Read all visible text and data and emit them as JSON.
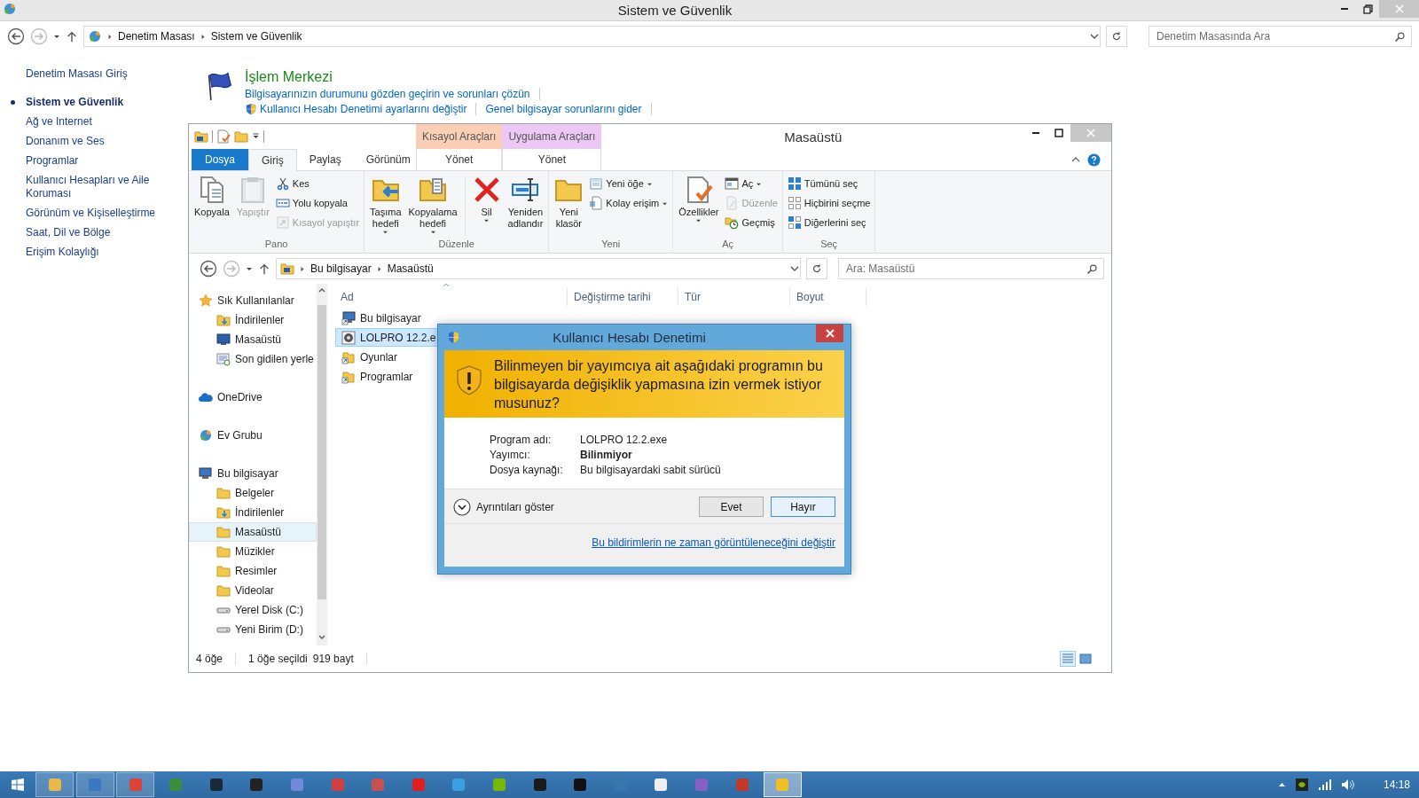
{
  "window": {
    "title": "Sistem ve Güvenlik"
  },
  "address_bar": {
    "path": [
      "Denetim Masası",
      "Sistem ve Güvenlik"
    ]
  },
  "search": {
    "placeholder": "Denetim Masasında Ara"
  },
  "sidebar": {
    "items": [
      {
        "label": "Denetim Masası Giriş",
        "kind": "home",
        "selected": false
      },
      {
        "label": "Sistem ve Güvenlik",
        "kind": "category",
        "selected": true
      },
      {
        "label": "Ağ ve Internet",
        "kind": "category",
        "selected": false
      },
      {
        "label": "Donanım ve Ses",
        "kind": "category",
        "selected": false
      },
      {
        "label": "Programlar",
        "kind": "category",
        "selected": false
      },
      {
        "label": "Kullanıcı Hesapları ve Aile Koruması",
        "kind": "category",
        "selected": false
      },
      {
        "label": "Görünüm ve Kişiselleştirme",
        "kind": "category",
        "selected": false
      },
      {
        "label": "Saat, Dil ve Bölge",
        "kind": "category",
        "selected": false
      },
      {
        "label": "Erişim Kolaylığı",
        "kind": "category",
        "selected": false
      }
    ]
  },
  "section": {
    "title": "İşlem Merkezi",
    "lines": [
      [
        {
          "label": "Bilgisayarınızın durumunu gözden geçirin ve sorunları çözün",
          "shield": false
        }
      ],
      [
        {
          "label": "Kullanıcı Hesabı Denetimi ayarlarını değiştir",
          "shield": true
        },
        {
          "label": "Genel bilgisayar sorunlarını gider",
          "shield": false
        }
      ]
    ]
  },
  "explorer": {
    "title": "Masaüstü",
    "tabs": [
      {
        "label": "Dosya",
        "kind": "file",
        "selected": false
      },
      {
        "label": "Giriş",
        "kind": "normal",
        "selected": true
      },
      {
        "label": "Paylaş",
        "kind": "normal",
        "selected": false
      },
      {
        "label": "Görünüm",
        "kind": "normal",
        "selected": false
      }
    ],
    "context_groups": [
      {
        "label": "Kısayol Araçları",
        "color": "#fbcfb6",
        "tabs": [
          {
            "label": "Yönet",
            "selected": false
          }
        ]
      },
      {
        "label": "Uygulama Araçları",
        "color": "#ecc8f4",
        "tabs": [
          {
            "label": "Yönet",
            "selected": false
          }
        ]
      }
    ],
    "groups": [
      {
        "label": "Pano",
        "items": [
          {
            "label": "Kopyala",
            "kind": "copy",
            "disabled": false,
            "dropdown": false
          },
          {
            "label": "Yapıştır",
            "kind": "paste",
            "disabled": true,
            "dropdown": false
          },
          {
            "label": "Kes",
            "kind": "cut",
            "disabled": false,
            "dropdown": false
          },
          {
            "label": "Yolu kopyala",
            "kind": "copypath",
            "disabled": false,
            "dropdown": false
          },
          {
            "label": "Kısayol yapıştır",
            "kind": "pasteshortcut",
            "disabled": true,
            "dropdown": false
          }
        ]
      },
      {
        "label": "Düzenle",
        "items": [
          {
            "label": "Taşıma\nhedefi",
            "kind": "move",
            "disabled": false,
            "dropdown": true
          },
          {
            "label": "Kopyalama\nhedefi",
            "kind": "copyto",
            "disabled": false,
            "dropdown": true
          },
          {
            "label": "Sil",
            "kind": "delete",
            "disabled": false,
            "dropdown": true
          },
          {
            "label": "Yeniden\nadlandır",
            "kind": "rename",
            "disabled": false,
            "dropdown": false
          }
        ]
      },
      {
        "label": "Yeni",
        "items": [
          {
            "label": "Yeni\nklasör",
            "kind": "newfolder",
            "disabled": false,
            "dropdown": false
          },
          {
            "label": "Yeni öğe",
            "kind": "newitem",
            "disabled": false,
            "dropdown": true
          },
          {
            "label": "Kolay erişim",
            "kind": "easyaccess",
            "disabled": false,
            "dropdown": true
          }
        ]
      },
      {
        "label": "Aç",
        "items": [
          {
            "label": "Özellikler",
            "kind": "properties",
            "disabled": false,
            "dropdown": true
          },
          {
            "label": "Aç",
            "kind": "open",
            "disabled": false,
            "dropdown": true
          },
          {
            "label": "Düzenle",
            "kind": "edit",
            "disabled": true,
            "dropdown": false
          },
          {
            "label": "Geçmiş",
            "kind": "history",
            "disabled": false,
            "dropdown": false
          }
        ]
      },
      {
        "label": "Seç",
        "items": [
          {
            "label": "Tümünü seç",
            "kind": "selectall",
            "disabled": false,
            "dropdown": false
          },
          {
            "label": "Hiçbirini seçme",
            "kind": "selectnone",
            "disabled": false,
            "dropdown": false
          },
          {
            "label": "Diğerlerini seç",
            "kind": "invert",
            "disabled": false,
            "dropdown": false
          }
        ]
      }
    ],
    "address_path": [
      "Bu bilgisayar",
      "Masaüstü"
    ],
    "search": {
      "placeholder": "Ara: Masaüstü"
    },
    "tree": [
      {
        "label": "Sık Kullanılanlar",
        "kind": "favorites",
        "selected": false,
        "children": [
          {
            "label": "İndirilenler",
            "kind": "downloads",
            "selected": false
          },
          {
            "label": "Masaüstü",
            "kind": "desktop",
            "selected": false
          },
          {
            "label": "Son gidilen yerle",
            "kind": "recent",
            "selected": false
          }
        ]
      },
      {
        "label": "OneDrive",
        "kind": "cloud",
        "selected": false
      },
      {
        "label": "Ev Grubu",
        "kind": "homegroup",
        "selected": false
      },
      {
        "label": "Bu bilgisayar",
        "kind": "computer",
        "selected": false,
        "children": [
          {
            "label": "Belgeler",
            "kind": "folder",
            "selected": false
          },
          {
            "label": "İndirilenler",
            "kind": "downloads",
            "selected": false
          },
          {
            "label": "Masaüstü",
            "kind": "folder",
            "selected": true
          },
          {
            "label": "Müzikler",
            "kind": "folder",
            "selected": false
          },
          {
            "label": "Resimler",
            "kind": "folder",
            "selected": false
          },
          {
            "label": "Videolar",
            "kind": "folder",
            "selected": false
          },
          {
            "label": "Yerel Disk (C:)",
            "kind": "drive",
            "selected": false
          },
          {
            "label": "Yeni Birim (D:)",
            "kind": "drive",
            "selected": false
          }
        ]
      }
    ],
    "columns": [
      "Ad",
      "Değiştirme tarihi",
      "Tür",
      "Boyut"
    ],
    "files": [
      {
        "name": "Bu bilgisayar",
        "kind": "computer",
        "selected": false
      },
      {
        "name": "LOLPRO 12.2.e",
        "kind": "program",
        "selected": true
      },
      {
        "name": "Oyunlar",
        "kind": "shortcut",
        "selected": false
      },
      {
        "name": "Programlar",
        "kind": "shortcut",
        "selected": false
      }
    ],
    "status": {
      "count": "4 öğe",
      "selection": "1 öğe seçildi",
      "size": "919 bayt"
    }
  },
  "dialog": {
    "title": "Kullanıcı Hesabı Denetimi",
    "question": "Bilinmeyen bir yayımcıya ait aşağıdaki programın bu bilgisayarda değişiklik yapmasına izin vermek istiyor musunuz?",
    "details": [
      {
        "label": "Program adı:",
        "value": "LOLPRO 12.2.exe",
        "bold": false
      },
      {
        "label": "Yayımcı:",
        "value": "Bilinmiyor",
        "bold": true
      },
      {
        "label": "Dosya kaynağı:",
        "value": "Bu bilgisayardaki sabit sürücü",
        "bold": false
      }
    ],
    "details_toggle": {
      "label": "Ayrıntıları göster",
      "expanded": false
    },
    "buttons": [
      {
        "label": "Evet",
        "default": false
      },
      {
        "label": "Hayır",
        "default": true
      }
    ],
    "link": "Bu bildirimlerin ne zaman görüntüleneceğini değiştir"
  },
  "taskbar": {
    "apps": [
      {
        "color": "#e8b84a",
        "open": true,
        "selected": false
      },
      {
        "color": "#3b78c4",
        "open": true,
        "selected": false
      },
      {
        "color": "#db4437",
        "open": true,
        "selected": false
      },
      {
        "color": "#3c8d3c",
        "open": false,
        "selected": false
      },
      {
        "color": "#1b2838",
        "open": false,
        "selected": false
      },
      {
        "color": "#222222",
        "open": false,
        "selected": false
      },
      {
        "color": "#7289da",
        "open": false,
        "selected": false
      },
      {
        "color": "#d04040",
        "open": false,
        "selected": false
      },
      {
        "color": "#c85050",
        "open": false,
        "selected": false
      },
      {
        "color": "#e02020",
        "open": false,
        "selected": false
      },
      {
        "color": "#3aa0e0",
        "open": false,
        "selected": false
      },
      {
        "color": "#76b900",
        "open": false,
        "selected": false
      },
      {
        "color": "#1a1a1a",
        "open": false,
        "selected": false
      },
      {
        "color": "#111111",
        "open": false,
        "selected": false
      },
      {
        "color": "#3776ab",
        "open": false,
        "selected": false
      },
      {
        "color": "#eeeeee",
        "open": false,
        "selected": false
      },
      {
        "color": "#8661c5",
        "open": false,
        "selected": false
      },
      {
        "color": "#c0392b",
        "open": false,
        "selected": false
      },
      {
        "color": "#f0c020",
        "open": true,
        "selected": true
      }
    ],
    "clock": "14:18"
  }
}
